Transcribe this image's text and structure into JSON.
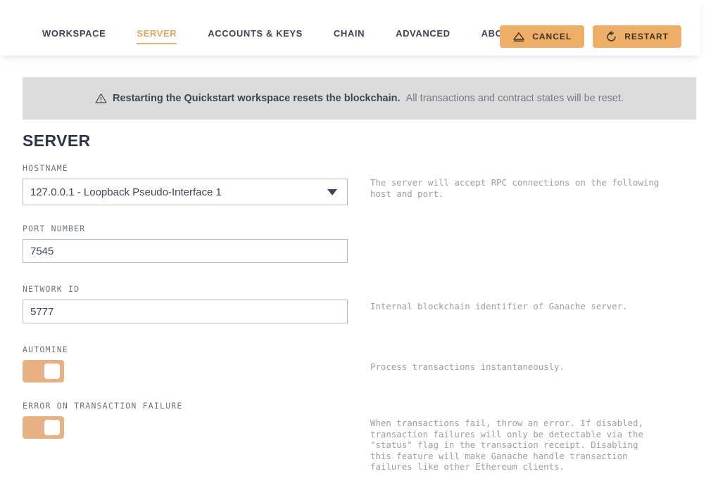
{
  "header": {
    "nav": [
      {
        "label": "WORKSPACE",
        "active": false
      },
      {
        "label": "SERVER",
        "active": true
      },
      {
        "label": "ACCOUNTS & KEYS",
        "active": false
      },
      {
        "label": "CHAIN",
        "active": false
      },
      {
        "label": "ADVANCED",
        "active": false
      },
      {
        "label": "ABOUT",
        "active": false
      }
    ],
    "cancel_button": {
      "label": "CANCEL",
      "icon": "eject-triangle-icon"
    },
    "restart_button": {
      "label": "RESTART",
      "icon": "restart-circular-arrow-icon"
    },
    "accent_color": "#eeae68",
    "active_tab_color": "#e5a663"
  },
  "banner": {
    "icon": "warning-triangle-icon",
    "strong_text": "Restarting the Quickstart workspace resets the blockchain.",
    "rest_text": "All transactions and contract states will be reset.",
    "background_color": "#dcdcdc"
  },
  "main": {
    "title": "SERVER",
    "fields": {
      "hostname": {
        "label": "HOSTNAME",
        "value": "127.0.0.1 - Loopback Pseudo-Interface 1",
        "description": "The server will accept RPC connections on the following\nhost and port."
      },
      "port_number": {
        "label": "PORT NUMBER",
        "value": "7545",
        "placeholder": "",
        "description": ""
      },
      "network_id": {
        "label": "NETWORK ID",
        "value": "5777",
        "placeholder": "",
        "description": "Internal blockchain identifier of Ganache server."
      },
      "automine": {
        "label": "AUTOMINE",
        "state": "on",
        "description": "Process transactions instantaneously."
      },
      "error_on_transaction_failure": {
        "label": "ERROR ON TRANSACTION FAILURE",
        "state": "on",
        "description": "When transactions fail, throw an error. If disabled,\ntransaction failures will only be detectable via the\n\"status\" flag in the transaction receipt. Disabling\nthis feature will make Ganache handle transaction\nfailures like other Ethereum clients."
      }
    }
  }
}
